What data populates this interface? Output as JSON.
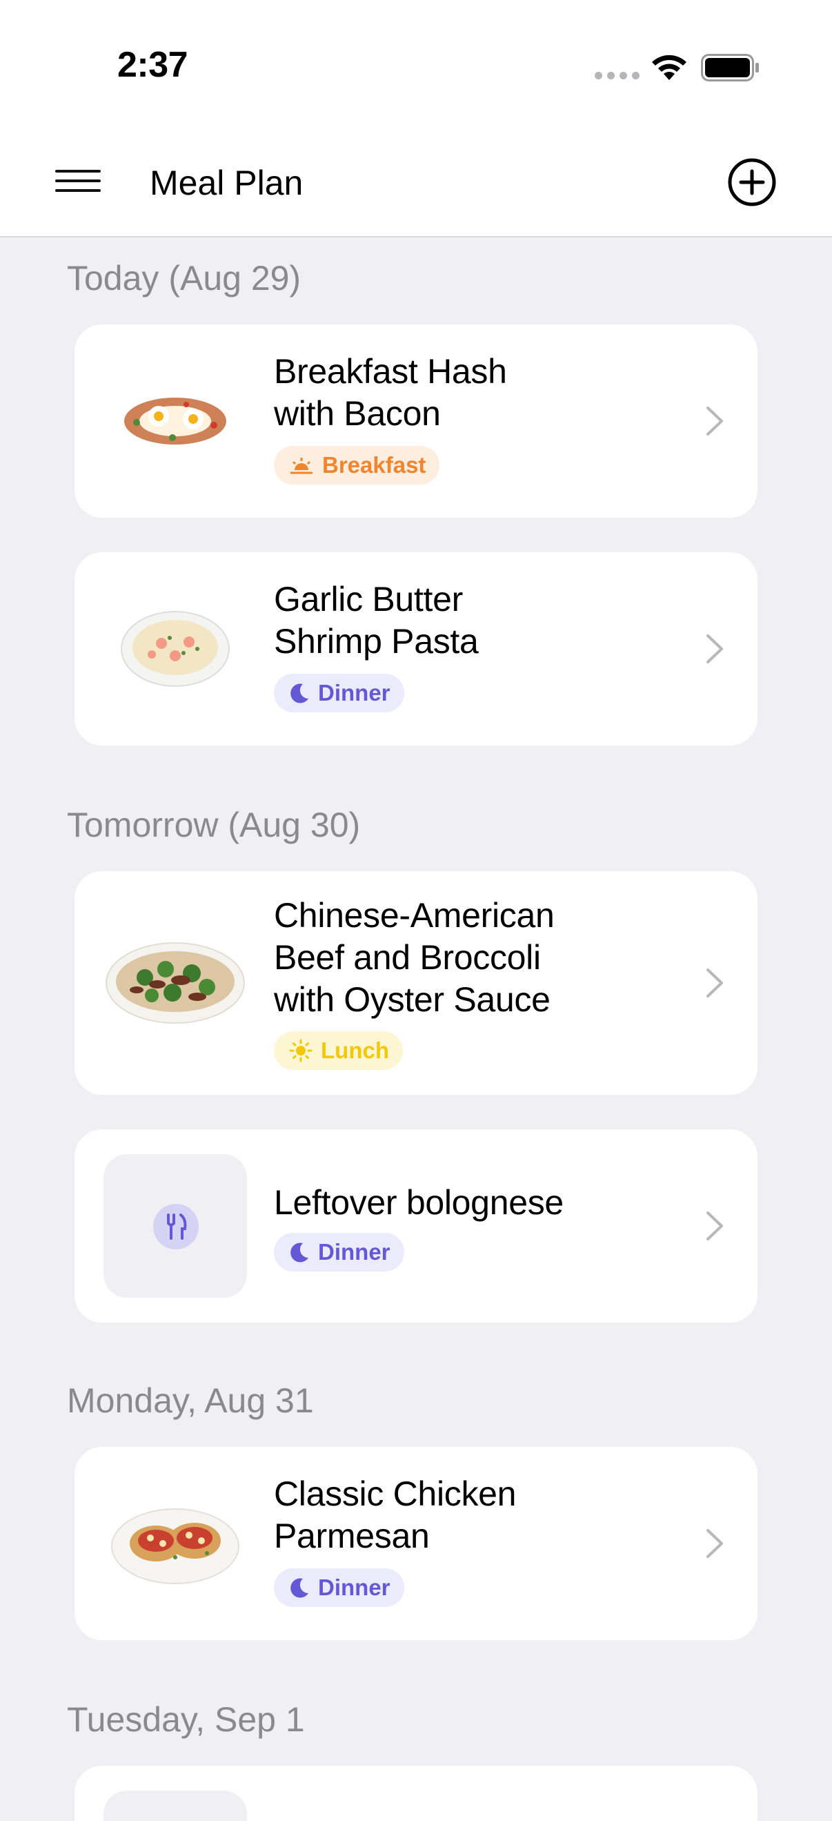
{
  "status_bar": {
    "time": "2:37"
  },
  "header": {
    "title": "Meal Plan"
  },
  "sections": [
    {
      "heading": "Today (Aug 29)",
      "meals": [
        {
          "title_lines": [
            "Breakfast Hash",
            "with Bacon"
          ],
          "meal_type": "Breakfast",
          "icon": "sunrise-icon"
        },
        {
          "title_lines": [
            "Garlic Butter",
            "Shrimp Pasta"
          ],
          "meal_type": "Dinner",
          "icon": "moon-icon"
        }
      ]
    },
    {
      "heading": "Tomorrow (Aug 30)",
      "meals": [
        {
          "title_lines": [
            "Chinese-American",
            "Beef and Broccoli",
            "with Oyster Sauce"
          ],
          "meal_type": "Lunch",
          "icon": "sun-icon"
        },
        {
          "title_lines": [
            "Leftover bolognese"
          ],
          "meal_type": "Dinner",
          "icon": "moon-icon"
        }
      ]
    },
    {
      "heading": "Monday, Aug 31",
      "meals": [
        {
          "title_lines": [
            "Classic Chicken",
            "Parmesan"
          ],
          "meal_type": "Dinner",
          "icon": "moon-icon"
        }
      ]
    },
    {
      "heading": "Tuesday, Sep 1",
      "meals": []
    }
  ],
  "colors": {
    "background": "#f0eff4",
    "breakfast": "#f0852e",
    "dinner": "#6558d6",
    "lunch": "#f2c80a"
  }
}
